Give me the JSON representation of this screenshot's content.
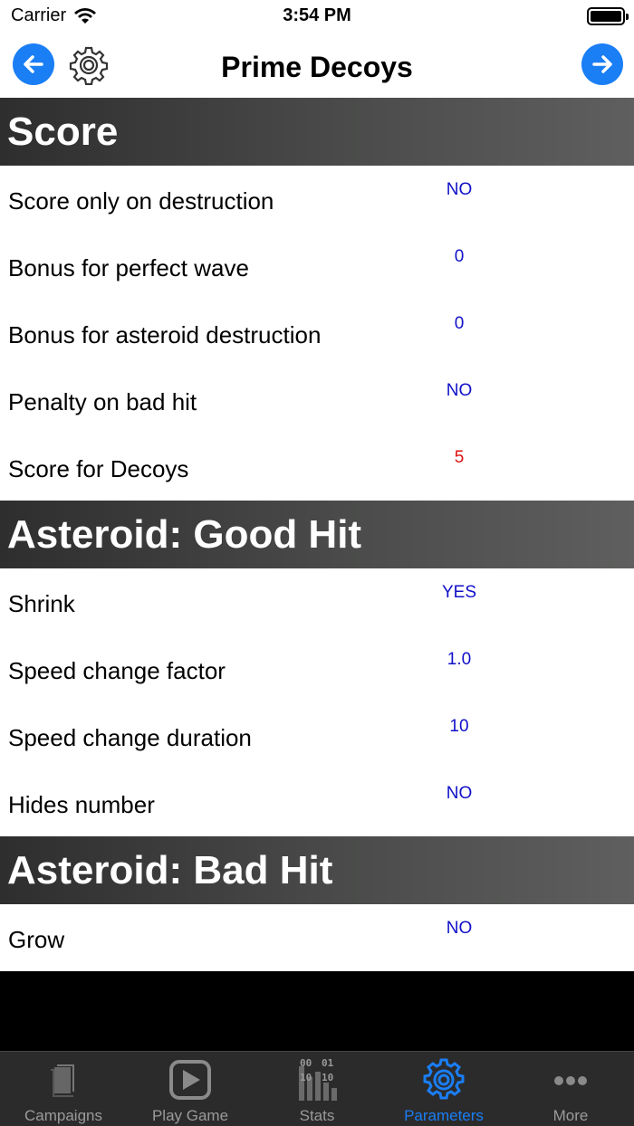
{
  "status": {
    "carrier": "Carrier",
    "time": "3:54 PM"
  },
  "nav": {
    "title": "Prime Decoys",
    "accent": "#1a7ef5"
  },
  "sections": [
    {
      "title": "Score",
      "rows": [
        {
          "label": "Score only on destruction",
          "value": "NO",
          "color": "blue"
        },
        {
          "label": "Bonus for perfect wave",
          "value": "0",
          "color": "blue"
        },
        {
          "label": "Bonus for asteroid destruction",
          "value": "0",
          "color": "blue"
        },
        {
          "label": "Penalty on bad hit",
          "value": "NO",
          "color": "blue"
        },
        {
          "label": "Score for Decoys",
          "value": "5",
          "color": "red"
        }
      ]
    },
    {
      "title": "Asteroid: Good Hit",
      "rows": [
        {
          "label": "Shrink",
          "value": "YES",
          "color": "blue"
        },
        {
          "label": "Speed change factor",
          "value": "1.0",
          "color": "blue"
        },
        {
          "label": "Speed change duration",
          "value": "10",
          "color": "blue"
        },
        {
          "label": "Hides number",
          "value": "NO",
          "color": "blue"
        }
      ]
    },
    {
      "title": "Asteroid: Bad Hit",
      "rows": [
        {
          "label": "Grow",
          "value": "NO",
          "color": "blue"
        }
      ]
    }
  ],
  "tabs": [
    {
      "label": "Campaigns",
      "icon": "campaigns-icon",
      "active": false
    },
    {
      "label": "Play Game",
      "icon": "play-icon",
      "active": false
    },
    {
      "label": "Stats",
      "icon": "stats-icon",
      "active": false
    },
    {
      "label": "Parameters",
      "icon": "gear-icon",
      "active": true
    },
    {
      "label": "More",
      "icon": "more-icon",
      "active": false
    }
  ]
}
